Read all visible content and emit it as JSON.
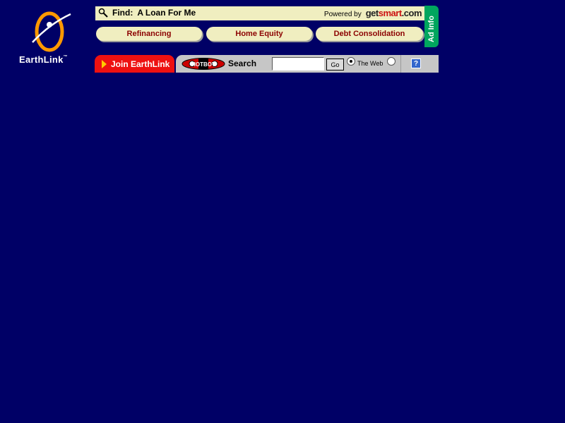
{
  "logo": {
    "brand": "EarthLink",
    "mark": "™"
  },
  "ad": {
    "find_label": "Find:",
    "query": "A Loan For Me",
    "powered_by": "Powered by",
    "partner_parts": [
      "get",
      "smart",
      ".com"
    ],
    "buttons": [
      {
        "label": "Refinancing"
      },
      {
        "label": "Home Equity"
      },
      {
        "label": "Debt Consolidation"
      }
    ],
    "info_label": "Ad Info"
  },
  "join": {
    "label": "Join EarthLink"
  },
  "search": {
    "engine_logo": "HOTBOT",
    "label": "Search",
    "value": "",
    "go_label": "Go",
    "scope_web_label": "The Web",
    "selected_scope": "The Web",
    "help_label": "?"
  },
  "colors": {
    "background": "#000066",
    "ad_panel": "#f0eec0",
    "ad_button_text": "#8b0000",
    "ad_info": "#00a65e",
    "join_tab": "#ee1111",
    "search_bar": "#c6c6c6"
  }
}
